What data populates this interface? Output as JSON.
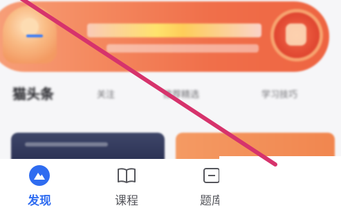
{
  "banner": {
    "icon": "promo-banner-image"
  },
  "tabs": {
    "active": "猫头条",
    "items": [
      "关注",
      "推荐精选",
      "学习技巧"
    ]
  },
  "bottom_nav": {
    "items": [
      {
        "label": "发现",
        "icon": "discover-mountain-icon",
        "active": true
      },
      {
        "label": "课程",
        "icon": "book-icon",
        "active": false
      },
      {
        "label": "题库",
        "icon": "question-bank-icon",
        "active": false
      }
    ]
  },
  "colors": {
    "accent_blue": "#2f6cf0",
    "banner_orange": "#f06f4a",
    "annotation_pink": "#d6336c",
    "card_dark": "#2b3154"
  }
}
